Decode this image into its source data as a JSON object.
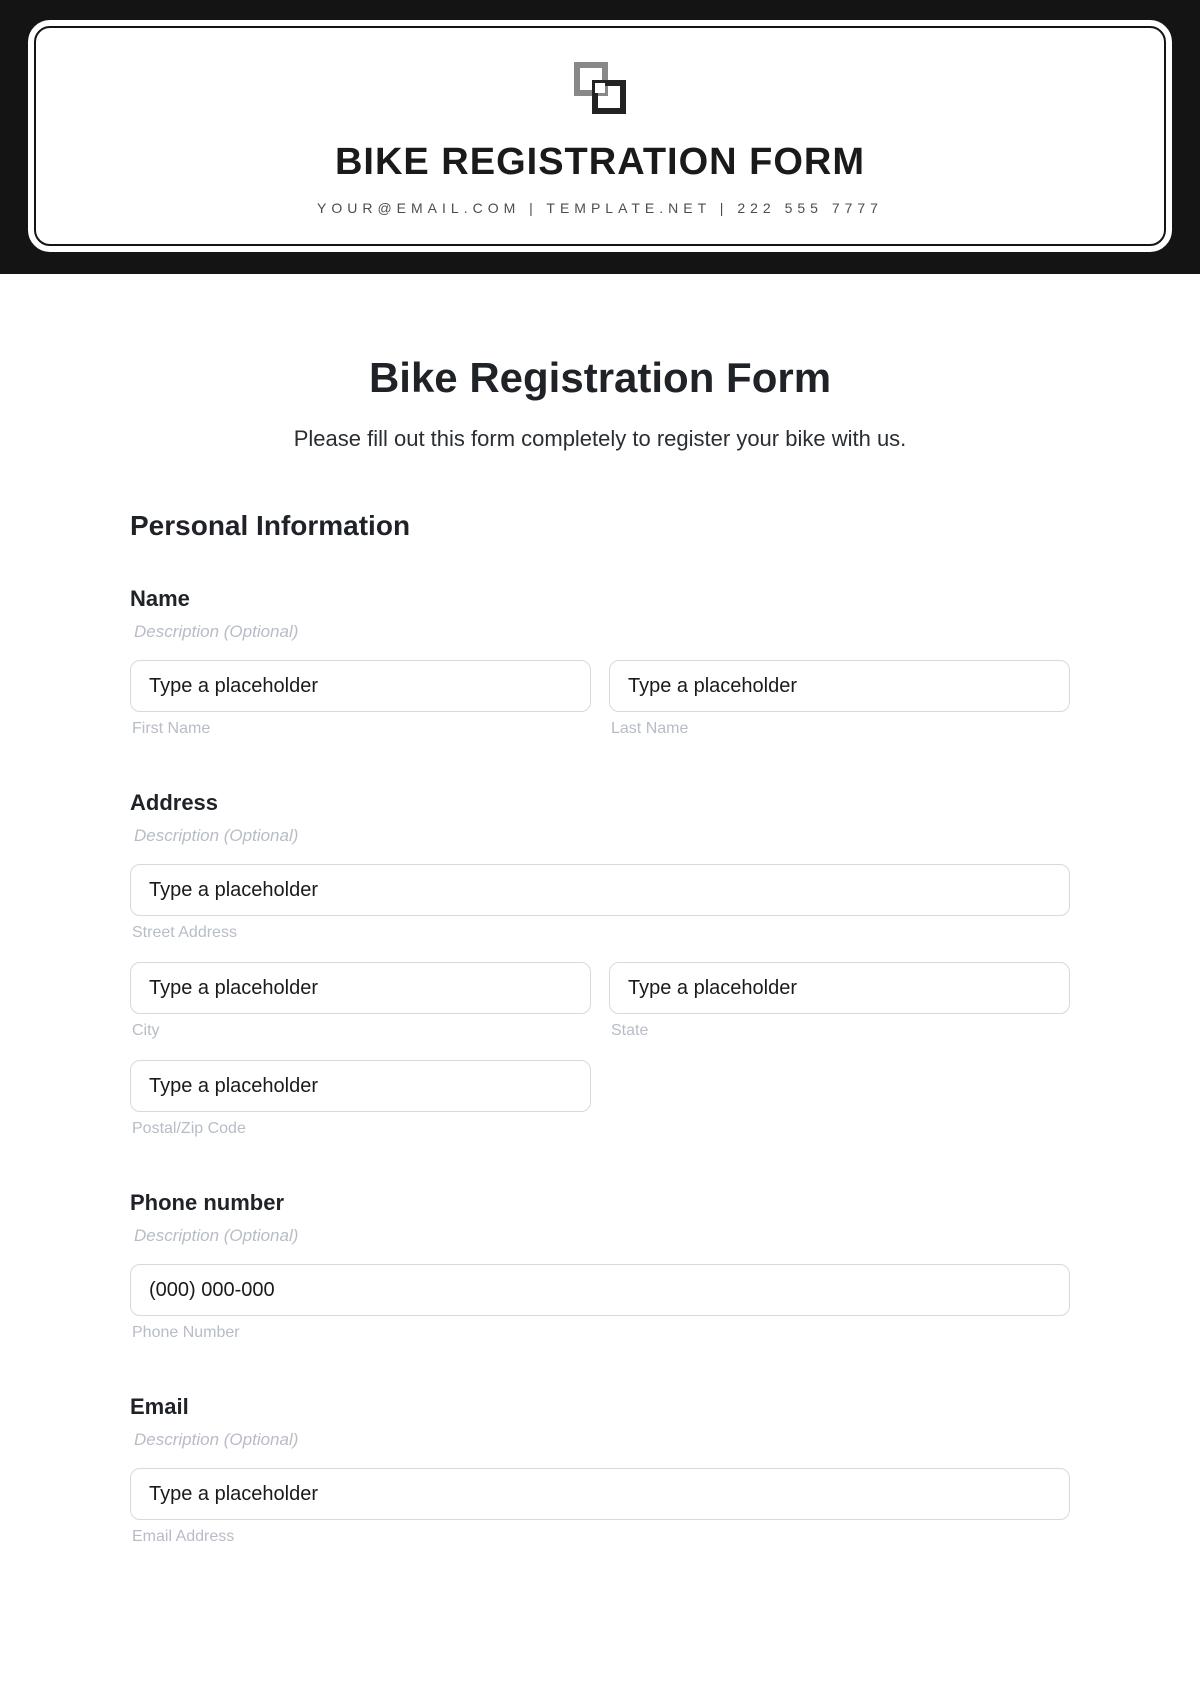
{
  "banner": {
    "title": "BIKE REGISTRATION FORM",
    "contact": "YOUR@EMAIL.COM | TEMPLATE.NET | 222 555 7777"
  },
  "page": {
    "title": "Bike Registration Form",
    "subtitle": "Please fill out this form completely to register your bike with us."
  },
  "section": {
    "personal": "Personal Information"
  },
  "name": {
    "label": "Name",
    "desc": "Description (Optional)",
    "first_sub": "First Name",
    "last_sub": "Last Name",
    "ph": "Type a placeholder"
  },
  "address": {
    "label": "Address",
    "desc": "Description (Optional)",
    "street_sub": "Street Address",
    "city_sub": "City",
    "state_sub": "State",
    "zip_sub": "Postal/Zip Code",
    "ph": "Type a placeholder"
  },
  "phone": {
    "label": "Phone number",
    "desc": "Description (Optional)",
    "sub": "Phone Number",
    "ph": "(000) 000-000"
  },
  "email": {
    "label": "Email",
    "desc": "Description (Optional)",
    "sub": "Email Address",
    "ph": "Type a placeholder"
  }
}
